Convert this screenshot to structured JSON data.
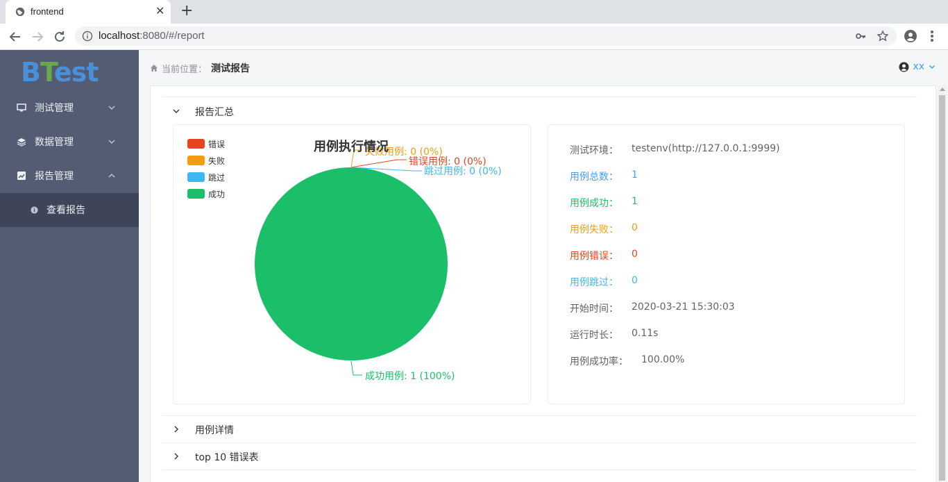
{
  "browser": {
    "tab_title": "frontend",
    "url_host": "localhost",
    "url_rest": ":8080/#/report"
  },
  "sidebar": {
    "logo_b": "B",
    "logo_t": "T",
    "logo_rest": "est",
    "items": [
      {
        "label": "测试管理"
      },
      {
        "label": "数据管理"
      },
      {
        "label": "报告管理"
      }
    ],
    "subitem": {
      "label": "查看报告"
    }
  },
  "header": {
    "breadcrumb_label": "当前位置：",
    "breadcrumb_current": "测试报告",
    "user": "xx"
  },
  "sections": [
    {
      "title": "报告汇总"
    },
    {
      "title": "用例详情"
    },
    {
      "title": "top 10 错误表"
    }
  ],
  "chart_data": {
    "type": "pie",
    "title": "用例执行情况",
    "legend": [
      "错误",
      "失败",
      "跳过",
      "成功"
    ],
    "series": [
      {
        "name": "错误",
        "label": "错误用例: 0 (0%)",
        "value": 0,
        "color": "#e8431c"
      },
      {
        "name": "失败",
        "label": "失败用例: 0 (0%)",
        "value": 0,
        "color": "#f39c12"
      },
      {
        "name": "跳过",
        "label": "跳过用例: 0 (0%)",
        "value": 0,
        "color": "#3eb6f2"
      },
      {
        "name": "成功",
        "label": "成功用例: 1 (100%)",
        "value": 1,
        "color": "#1bbf6a"
      }
    ],
    "legend_placement": "top-left"
  },
  "summary": {
    "env_label": "测试环境：",
    "env_value": "testenv(http://127.0.0.1:9999)",
    "total_label": "用例总数：",
    "total_value": "1",
    "success_label": "用例成功：",
    "success_value": "1",
    "fail_label": "用例失败：",
    "fail_value": "0",
    "error_label": "用例错误：",
    "error_value": "0",
    "skip_label": "用例跳过：",
    "skip_value": "0",
    "start_label": "开始时间：",
    "start_value": "2020-03-21 15:30:03",
    "duration_label": "运行时长：",
    "duration_value": "0.11s",
    "rate_label": "用例成功率：",
    "rate_value": "100.00%"
  },
  "colors": {
    "blue": "#409eff",
    "green": "#1bbf6a",
    "orange": "#f39c12",
    "red": "#e8431c",
    "cyan": "#3eb6f2",
    "sidebar": "#545c73"
  }
}
